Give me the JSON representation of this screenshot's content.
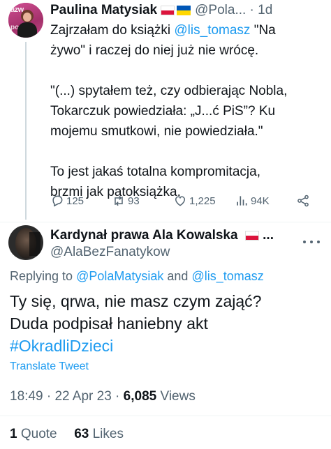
{
  "tweet1": {
    "author_name": "Paulina Matysiak",
    "author_handle": "@Pola...",
    "separator": " · ",
    "time": "1d",
    "avatar_text_top": "azw",
    "avatar_text_bottom": "po",
    "body_line1_a": "Zajrzałam do książki ",
    "body_line1_link": "@lis_tomasz",
    "body_line1_b": " \"Na",
    "body_line2": "żywo\" i raczej do niej już nie wrócę.",
    "body_line3": "\"(...) spytałem też, czy odbierając Nobla,",
    "body_line4": "Tokarczuk powiedziała: „J...ć PiS”? Ku",
    "body_line5": "mojemu smutkowi, nie powiedziała.\"",
    "body_line6": "To jest jakaś totalna kompromitacja,",
    "body_line7": "brzmi jak patoksiążka.",
    "actions": {
      "replies": "125",
      "retweets": "93",
      "likes": "1,225",
      "views": "94K"
    }
  },
  "tweet2": {
    "author_name": "Kardynał prawa Ala Kowalska",
    "name_ellipsis": " ...",
    "author_handle": "@AlaBezFanatykow",
    "reply_prefix": "Replying to ",
    "reply_user1": "@PolaMatysiak",
    "reply_and": " and ",
    "reply_user2": "@lis_tomasz",
    "body_line1": "Ty się, qrwa, nie masz czym zająć?",
    "body_line2": "Duda podpisał haniebny akt",
    "body_hashtag": "#OkradliDzieci",
    "translate_label": "Translate Tweet",
    "time": "18:49",
    "date": "22 Apr 23",
    "dot": " · ",
    "views_count": "6,085",
    "views_label": " Views",
    "quotes_count": "1",
    "quotes_label": " Quote",
    "likes_count": "63",
    "likes_label": " Likes"
  },
  "colors": {
    "link": "#1d9bf0",
    "muted": "#536471",
    "text": "#0f1419",
    "flag_ua_blue": "#0057b7",
    "flag_ua_yellow": "#ffd700",
    "flag_pl_red": "#dc143c"
  },
  "icons": [
    "reply-icon",
    "retweet-icon",
    "like-icon",
    "views-icon",
    "share-icon",
    "more-icon"
  ]
}
